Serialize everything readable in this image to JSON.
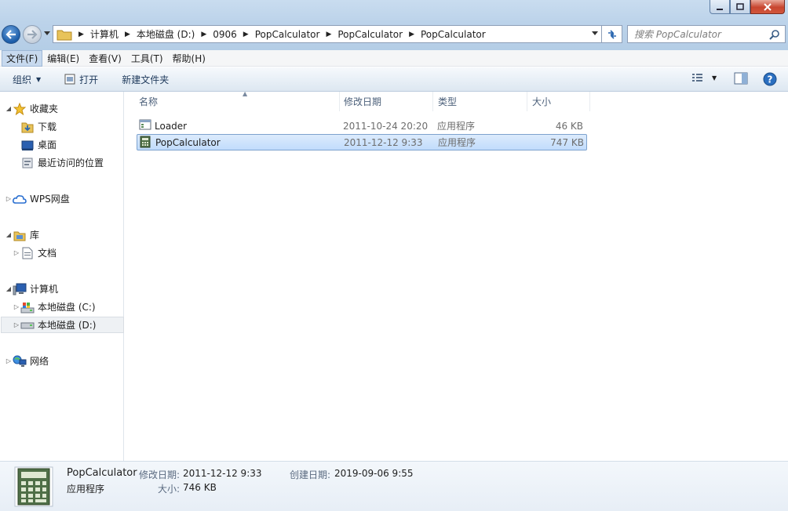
{
  "address": {
    "crumbs": [
      "计算机",
      "本地磁盘 (D:)",
      "0906",
      "PopCalculator",
      "PopCalculator",
      "PopCalculator"
    ]
  },
  "search": {
    "placeholder": "搜索 PopCalculator"
  },
  "menu": [
    "文件(F)",
    "编辑(E)",
    "查看(V)",
    "工具(T)",
    "帮助(H)"
  ],
  "toolbar": {
    "organize": "组织",
    "open": "打开",
    "new_folder": "新建文件夹"
  },
  "nav": {
    "favorites": "收藏夹",
    "downloads": "下载",
    "desktop": "桌面",
    "recent": "最近访问的位置",
    "wps": "WPS网盘",
    "library": "库",
    "documents": "文档",
    "computer": "计算机",
    "drive_c": "本地磁盘 (C:)",
    "drive_d": "本地磁盘 (D:)",
    "network": "网络"
  },
  "columns": {
    "name": "名称",
    "modified": "修改日期",
    "type": "类型",
    "size": "大小"
  },
  "files": [
    {
      "name": "Loader",
      "modified": "2011-10-24 20:20",
      "type": "应用程序",
      "size": "46 KB"
    },
    {
      "name": "PopCalculator",
      "modified": "2011-12-12 9:33",
      "type": "应用程序",
      "size": "747 KB"
    }
  ],
  "details": {
    "name": "PopCalculator",
    "kind": "应用程序",
    "modified_label": "修改日期:",
    "modified_value": "2011-12-12 9:33",
    "created_label": "创建日期:",
    "created_value": "2019-09-06 9:55",
    "size_label": "大小:",
    "size_value": "746 KB"
  },
  "icons": {
    "back": "back-arrow-icon",
    "forward": "forward-arrow-icon",
    "refresh": "refresh-icon",
    "search": "search-icon",
    "help": "help-icon"
  },
  "colors": {
    "accent": "#1b5ca8",
    "selection": "#c1dcfc",
    "selection_border": "#7da2ce",
    "close": "#c8452f"
  }
}
